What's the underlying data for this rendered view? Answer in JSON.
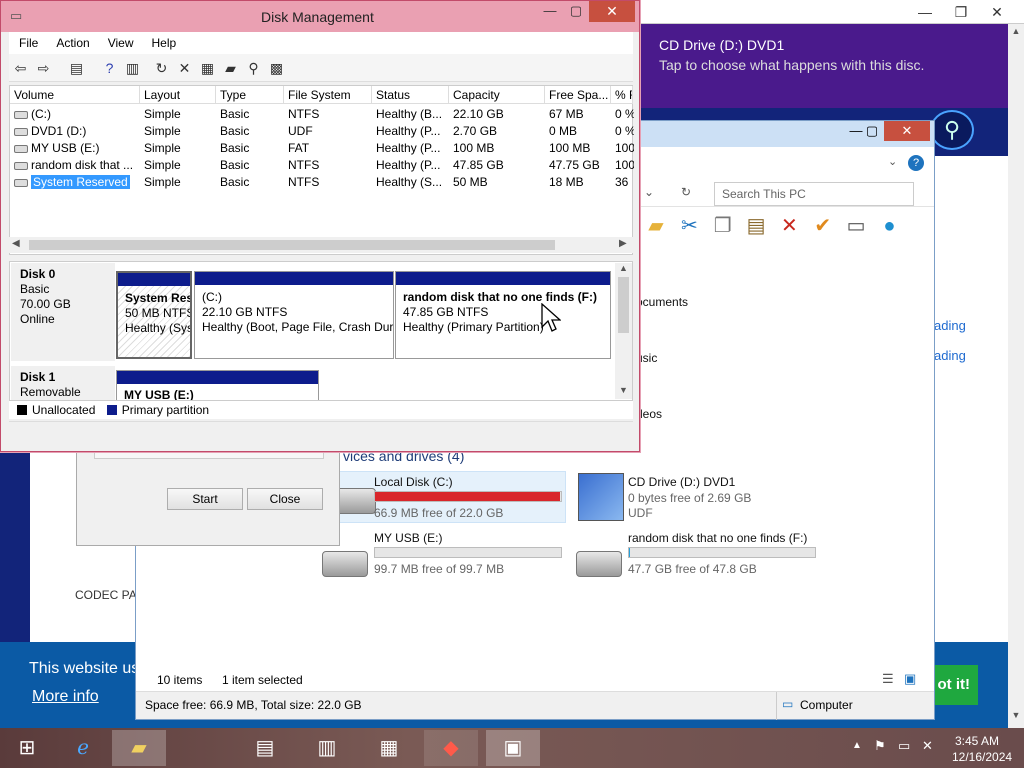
{
  "browser": {
    "side_items": [
      "CODEC PA"
    ],
    "links": [
      "ading",
      "ading"
    ],
    "cookie": {
      "text": "This website us",
      "more": "More info",
      "button": "ot it!"
    }
  },
  "toast": {
    "title": "CD Drive (D:) DVD1",
    "subtitle": "Tap to choose what happens with this disc."
  },
  "explorer": {
    "search_placeholder": "Search This PC",
    "folders": [
      "ocuments",
      "usic",
      "deos"
    ],
    "section": "vices and drives (4)",
    "drives": [
      {
        "name": "Local Disk (C:)",
        "sub": "66.9 MB free of 22.0 GB",
        "used": 0.997,
        "color": "#d9262b"
      },
      {
        "name": "CD Drive (D:) DVD1",
        "sub": "0 bytes free of 2.69 GB",
        "sub2": "UDF"
      },
      {
        "name": "MY USB (E:)",
        "sub": "99.7 MB free of 99.7 MB",
        "used": 0.0,
        "color": "#26a0da"
      },
      {
        "name": "random disk that no one finds (F:)",
        "sub": "47.7 GB free of 47.8 GB",
        "used": 0.002,
        "color": "#26a0da"
      }
    ],
    "status": {
      "items": "10 items",
      "selected": "1 item selected"
    },
    "bottom": {
      "space": "Space free: 66.9 MB, Total size: 22.0 GB",
      "location": "Computer"
    }
  },
  "wizard": {
    "start": "Start",
    "close": "Close"
  },
  "dm": {
    "title": "Disk Management",
    "menu": [
      "File",
      "Action",
      "View",
      "Help"
    ],
    "columns": [
      "Volume",
      "Layout",
      "Type",
      "File System",
      "Status",
      "Capacity",
      "Free Spa...",
      "% F"
    ],
    "rows": [
      [
        "(C:)",
        "Simple",
        "Basic",
        "NTFS",
        "Healthy (B...",
        "22.10 GB",
        "67 MB",
        "0 %"
      ],
      [
        "DVD1 (D:)",
        "Simple",
        "Basic",
        "UDF",
        "Healthy (P...",
        "2.70 GB",
        "0 MB",
        "0 %"
      ],
      [
        "MY USB (E:)",
        "Simple",
        "Basic",
        "FAT",
        "Healthy (P...",
        "100 MB",
        "100 MB",
        "100"
      ],
      [
        "random disk that ...",
        "Simple",
        "Basic",
        "NTFS",
        "Healthy (P...",
        "47.85 GB",
        "47.75 GB",
        "100"
      ],
      [
        "System Reserved",
        "Simple",
        "Basic",
        "NTFS",
        "Healthy (S...",
        "50 MB",
        "18 MB",
        "36"
      ]
    ],
    "disk0": {
      "name": "Disk 0",
      "type": "Basic",
      "size": "70.00 GB",
      "state": "Online",
      "parts": [
        {
          "title": "System Res",
          "size": "50 MB NTFS",
          "status": "Healthy (Sys"
        },
        {
          "title": "(C:)",
          "size": "22.10 GB NTFS",
          "status": "Healthy (Boot, Page File, Crash Dur"
        },
        {
          "title": "random disk that no one finds  (F:)",
          "size": "47.85 GB NTFS",
          "status": "Healthy (Primary Partition)"
        }
      ]
    },
    "disk1": {
      "name": "Disk 1",
      "type": "Removable",
      "part": "MY USB  (E:)"
    },
    "legend": [
      "Unallocated",
      "Primary partition"
    ]
  },
  "taskbar": {
    "time": "3:45 AM",
    "date": "12/16/2024"
  },
  "colors": {
    "dm_border": "#c24b6a",
    "partition_header": "#0d1c8c",
    "selected": "#3399ff"
  }
}
